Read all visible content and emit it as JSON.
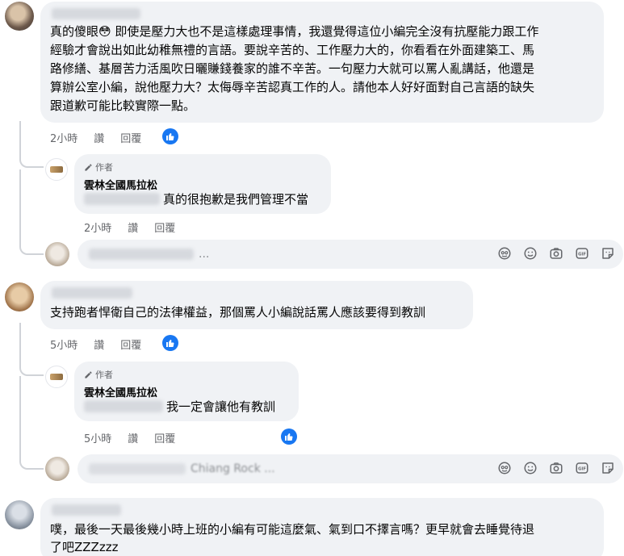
{
  "comments": [
    {
      "text": "真的傻眼😳 即使是壓力大也不是這樣處理事情，我還覺得這位小編完全沒有抗壓能力跟工作經驗才會說出如此幼稚無禮的言語。要說辛苦的、工作壓力大的，你看看在外面建築工、馬路修繕、基層苦力活風吹日曬賺錢養家的誰不辛苦。一句壓力大就可以罵人亂講話，他還是算辦公室小編，說他壓力大？太侮辱辛苦認真工作的人。請他本人好好面對自己言語的缺失跟道歉可能比較實際一點。",
      "lines": [
        "真的傻眼😳 即使是壓力大也不是這樣處理事情，我還覺得這位小編完全沒有抗壓能力跟工作",
        "經驗才會說出如此幼稚無禮的言語。要說辛苦的、工作壓力大的，你看看在外面建築工、馬",
        "路修繕、基層苦力活風吹日曬賺錢養家的誰不辛苦。一句壓力大就可以罵人亂講話，他還是",
        "算辦公室小編，說他壓力大？太侮辱辛苦認真工作的人。請他本人好好面對自己言語的缺失",
        "跟道歉可能比較實際一點。"
      ],
      "time": "2小時",
      "like": "讚",
      "reply": "回覆",
      "reply_item": {
        "badge": "作者",
        "author": "雲林全國馬拉松",
        "text": "真的很抱歉是我們管理不當",
        "time": "2小時",
        "like": "讚",
        "reply": "回覆"
      },
      "reply_placeholder": "..."
    },
    {
      "author": "Chiang Rock",
      "text": "支持跑者悍衛自己的法律權益，那個罵人小編說話罵人應該要得到教訓",
      "time": "5小時",
      "like": "讚",
      "reply": "回覆",
      "reply_item": {
        "badge": "作者",
        "author": "雲林全國馬拉松",
        "text": "我一定會讓他有教訓",
        "time": "5小時",
        "like": "讚",
        "reply": "回覆"
      },
      "reply_placeholder": "Chiang Rock ..."
    },
    {
      "lines": [
        "噗，最後一天最後幾小時上班的小編有可能這麼氣、氣到口不擇言嗎？更早就會去睡覺待退",
        "了吧ZZZzzz"
      ]
    }
  ],
  "icons": [
    "avatar-sticker-icon",
    "emoji-icon",
    "camera-icon",
    "gif-icon",
    "sticker-icon",
    "like-icon",
    "pencil-icon"
  ],
  "colors": {
    "bubble": "#f0f2f5",
    "meta": "#65676b",
    "like_blue": "#1877f2"
  }
}
